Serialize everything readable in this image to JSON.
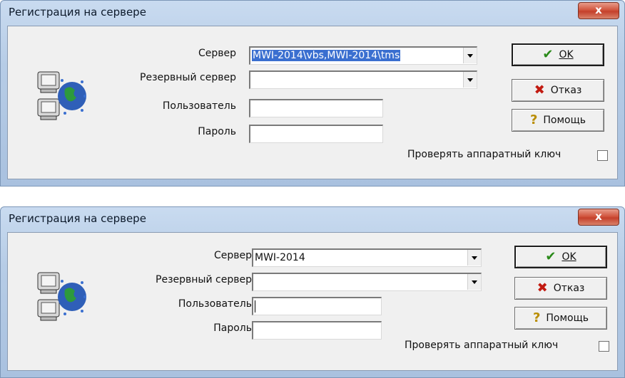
{
  "dialogs": [
    {
      "title": "Регистрация на сервере",
      "close_glyph": "x",
      "labels": {
        "server": "Сервер",
        "reserve": "Резервный сервер",
        "user": "Пользователь",
        "password": "Пароль"
      },
      "server_value": "MWI-2014\\vbs,MWI-2014\\tms",
      "reserve_value": "",
      "user_value": "",
      "password_value": "",
      "buttons": {
        "ok": "OK",
        "cancel": "Отказ",
        "help": "Помощь"
      },
      "check_label": "Проверять аппаратный ключ"
    },
    {
      "title": "Регистрация на сервере",
      "close_glyph": "x",
      "labels": {
        "server": "Сервер",
        "reserve": "Резервный сервер",
        "user": "Пользователь",
        "password": "Пароль"
      },
      "server_value": "MWI-2014",
      "reserve_value": "",
      "user_value": "",
      "password_value": "",
      "buttons": {
        "ok": "OK",
        "cancel": "Отказ",
        "help": "Помощь"
      },
      "check_label": "Проверять аппаратный ключ"
    }
  ],
  "icons": {
    "app": "network-computers-globe-icon",
    "ok": "checkmark-icon",
    "cancel": "red-x-icon",
    "help": "question-mark-icon"
  },
  "colors": {
    "selection": "#3a6fd0",
    "close_button": "#c4402b",
    "ok_check": "#2a8a1a",
    "cancel_x": "#c21a10",
    "help_q": "#b98d00"
  }
}
